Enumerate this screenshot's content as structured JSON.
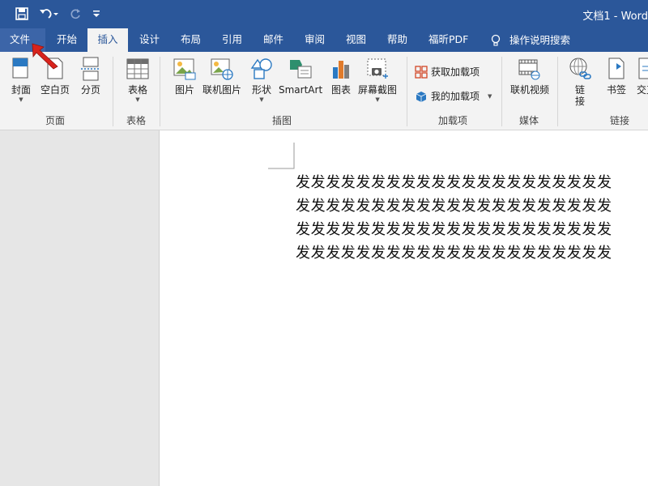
{
  "window": {
    "title": "文档1 - Word"
  },
  "qat": {
    "save_icon": "save-icon",
    "undo_icon": "undo-icon",
    "redo_icon": "redo-icon",
    "customize_icon": "customize-qat-icon"
  },
  "tabs": [
    {
      "label": "文件"
    },
    {
      "label": "开始"
    },
    {
      "label": "插入"
    },
    {
      "label": "设计"
    },
    {
      "label": "布局"
    },
    {
      "label": "引用"
    },
    {
      "label": "邮件"
    },
    {
      "label": "审阅"
    },
    {
      "label": "视图"
    },
    {
      "label": "帮助"
    },
    {
      "label": "福昕PDF"
    },
    {
      "label": "操作说明搜索"
    }
  ],
  "active_tab": "插入",
  "ribbon": {
    "pages": {
      "group_label": "页面",
      "cover": "封面",
      "blank_page": "空白页",
      "page_break": "分页"
    },
    "tables": {
      "group_label": "表格",
      "table": "表格"
    },
    "illustrations": {
      "group_label": "插图",
      "pictures": "图片",
      "online_pictures": "联机图片",
      "shapes": "形状",
      "smartart": "SmartArt",
      "chart": "图表",
      "screenshot": "屏幕截图"
    },
    "addins": {
      "group_label": "加载项",
      "get_addins": "获取加载项",
      "my_addins": "我的加载项"
    },
    "media": {
      "group_label": "媒体",
      "online_video": "联机视频"
    },
    "links": {
      "group_label": "链接",
      "link_line1": "链",
      "link_line2": "接",
      "bookmark": "书签",
      "cross_ref": "交叉"
    }
  },
  "document": {
    "lines": [
      "发发发发发发发发发发发发发发发发发发发发发",
      "发发发发发发发发发发发发发发发发发发发发发",
      "发发发发发发发发发发发发发发发发发发发发发",
      "发发发发发发发发发发发发发发发发发发发发发"
    ]
  },
  "colors": {
    "title_bar": "#2b579a",
    "ribbon_bg": "#f3f3f3",
    "pointer_red": "#d9231c"
  }
}
